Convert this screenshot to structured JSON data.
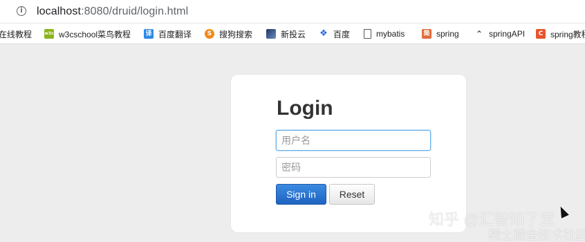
{
  "browser": {
    "url_host": "localhost",
    "url_rest": ":8080/druid/login.html"
  },
  "bookmarks": [
    {
      "label": "在线教程",
      "icon": "none",
      "color": ""
    },
    {
      "label": "w3cschool菜鸟教程",
      "icon": "w3c-logo-icon",
      "icon_text": "w3c",
      "color": "#8bb31d"
    },
    {
      "label": "百度翻译",
      "icon": "baidu-translate-icon",
      "icon_text": "译",
      "color": "#2e8ae6"
    },
    {
      "label": "搜狗搜索",
      "icon": "sogou-icon",
      "icon_text": "S",
      "color": "#f08a1b"
    },
    {
      "label": "新投云",
      "icon": "xintouyun-icon",
      "icon_text": "",
      "color": "#2b4b7e"
    },
    {
      "label": "百度",
      "icon": "baidu-paw-icon",
      "icon_text": "",
      "color": "#2f6bd8"
    },
    {
      "label": "mybatis",
      "icon": "document-icon",
      "icon_text": "",
      "color": "#ffffff"
    },
    {
      "label": "spring",
      "icon": "jian-icon",
      "icon_text": "简",
      "color": "#e06c3c"
    },
    {
      "label": "springAPI",
      "icon": "spring-api-icon",
      "icon_text": "",
      "color": "#ffffff"
    },
    {
      "label": "spring教程",
      "icon": "c-logo-icon",
      "icon_text": "C",
      "color": "#e8542c"
    }
  ],
  "login": {
    "title": "Login",
    "username_placeholder": "用户名",
    "password_placeholder": "密码",
    "signin_label": "Sign in",
    "reset_label": "Reset"
  },
  "watermark": {
    "line1": "知乎 @汇智知了堂",
    "line2": "稀土掘金技术社区"
  }
}
